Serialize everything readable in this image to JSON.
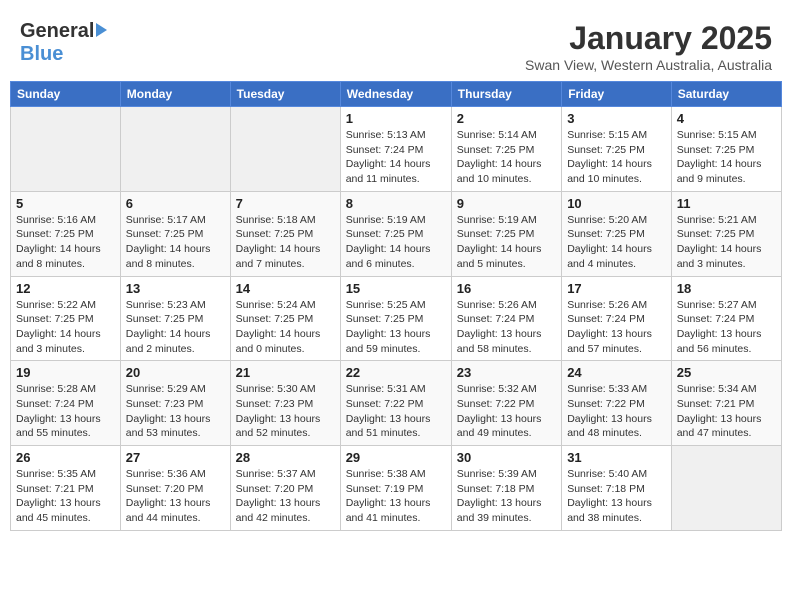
{
  "header": {
    "logo_general": "General",
    "logo_blue": "Blue",
    "title": "January 2025",
    "subtitle": "Swan View, Western Australia, Australia"
  },
  "days_of_week": [
    "Sunday",
    "Monday",
    "Tuesday",
    "Wednesday",
    "Thursday",
    "Friday",
    "Saturday"
  ],
  "weeks": [
    [
      {
        "day": "",
        "info": ""
      },
      {
        "day": "",
        "info": ""
      },
      {
        "day": "",
        "info": ""
      },
      {
        "day": "1",
        "sunrise": "Sunrise: 5:13 AM",
        "sunset": "Sunset: 7:24 PM",
        "daylight": "Daylight: 14 hours and 11 minutes."
      },
      {
        "day": "2",
        "sunrise": "Sunrise: 5:14 AM",
        "sunset": "Sunset: 7:25 PM",
        "daylight": "Daylight: 14 hours and 10 minutes."
      },
      {
        "day": "3",
        "sunrise": "Sunrise: 5:15 AM",
        "sunset": "Sunset: 7:25 PM",
        "daylight": "Daylight: 14 hours and 10 minutes."
      },
      {
        "day": "4",
        "sunrise": "Sunrise: 5:15 AM",
        "sunset": "Sunset: 7:25 PM",
        "daylight": "Daylight: 14 hours and 9 minutes."
      }
    ],
    [
      {
        "day": "5",
        "sunrise": "Sunrise: 5:16 AM",
        "sunset": "Sunset: 7:25 PM",
        "daylight": "Daylight: 14 hours and 8 minutes."
      },
      {
        "day": "6",
        "sunrise": "Sunrise: 5:17 AM",
        "sunset": "Sunset: 7:25 PM",
        "daylight": "Daylight: 14 hours and 8 minutes."
      },
      {
        "day": "7",
        "sunrise": "Sunrise: 5:18 AM",
        "sunset": "Sunset: 7:25 PM",
        "daylight": "Daylight: 14 hours and 7 minutes."
      },
      {
        "day": "8",
        "sunrise": "Sunrise: 5:19 AM",
        "sunset": "Sunset: 7:25 PM",
        "daylight": "Daylight: 14 hours and 6 minutes."
      },
      {
        "day": "9",
        "sunrise": "Sunrise: 5:19 AM",
        "sunset": "Sunset: 7:25 PM",
        "daylight": "Daylight: 14 hours and 5 minutes."
      },
      {
        "day": "10",
        "sunrise": "Sunrise: 5:20 AM",
        "sunset": "Sunset: 7:25 PM",
        "daylight": "Daylight: 14 hours and 4 minutes."
      },
      {
        "day": "11",
        "sunrise": "Sunrise: 5:21 AM",
        "sunset": "Sunset: 7:25 PM",
        "daylight": "Daylight: 14 hours and 3 minutes."
      }
    ],
    [
      {
        "day": "12",
        "sunrise": "Sunrise: 5:22 AM",
        "sunset": "Sunset: 7:25 PM",
        "daylight": "Daylight: 14 hours and 3 minutes."
      },
      {
        "day": "13",
        "sunrise": "Sunrise: 5:23 AM",
        "sunset": "Sunset: 7:25 PM",
        "daylight": "Daylight: 14 hours and 2 minutes."
      },
      {
        "day": "14",
        "sunrise": "Sunrise: 5:24 AM",
        "sunset": "Sunset: 7:25 PM",
        "daylight": "Daylight: 14 hours and 0 minutes."
      },
      {
        "day": "15",
        "sunrise": "Sunrise: 5:25 AM",
        "sunset": "Sunset: 7:25 PM",
        "daylight": "Daylight: 13 hours and 59 minutes."
      },
      {
        "day": "16",
        "sunrise": "Sunrise: 5:26 AM",
        "sunset": "Sunset: 7:24 PM",
        "daylight": "Daylight: 13 hours and 58 minutes."
      },
      {
        "day": "17",
        "sunrise": "Sunrise: 5:26 AM",
        "sunset": "Sunset: 7:24 PM",
        "daylight": "Daylight: 13 hours and 57 minutes."
      },
      {
        "day": "18",
        "sunrise": "Sunrise: 5:27 AM",
        "sunset": "Sunset: 7:24 PM",
        "daylight": "Daylight: 13 hours and 56 minutes."
      }
    ],
    [
      {
        "day": "19",
        "sunrise": "Sunrise: 5:28 AM",
        "sunset": "Sunset: 7:24 PM",
        "daylight": "Daylight: 13 hours and 55 minutes."
      },
      {
        "day": "20",
        "sunrise": "Sunrise: 5:29 AM",
        "sunset": "Sunset: 7:23 PM",
        "daylight": "Daylight: 13 hours and 53 minutes."
      },
      {
        "day": "21",
        "sunrise": "Sunrise: 5:30 AM",
        "sunset": "Sunset: 7:23 PM",
        "daylight": "Daylight: 13 hours and 52 minutes."
      },
      {
        "day": "22",
        "sunrise": "Sunrise: 5:31 AM",
        "sunset": "Sunset: 7:22 PM",
        "daylight": "Daylight: 13 hours and 51 minutes."
      },
      {
        "day": "23",
        "sunrise": "Sunrise: 5:32 AM",
        "sunset": "Sunset: 7:22 PM",
        "daylight": "Daylight: 13 hours and 49 minutes."
      },
      {
        "day": "24",
        "sunrise": "Sunrise: 5:33 AM",
        "sunset": "Sunset: 7:22 PM",
        "daylight": "Daylight: 13 hours and 48 minutes."
      },
      {
        "day": "25",
        "sunrise": "Sunrise: 5:34 AM",
        "sunset": "Sunset: 7:21 PM",
        "daylight": "Daylight: 13 hours and 47 minutes."
      }
    ],
    [
      {
        "day": "26",
        "sunrise": "Sunrise: 5:35 AM",
        "sunset": "Sunset: 7:21 PM",
        "daylight": "Daylight: 13 hours and 45 minutes."
      },
      {
        "day": "27",
        "sunrise": "Sunrise: 5:36 AM",
        "sunset": "Sunset: 7:20 PM",
        "daylight": "Daylight: 13 hours and 44 minutes."
      },
      {
        "day": "28",
        "sunrise": "Sunrise: 5:37 AM",
        "sunset": "Sunset: 7:20 PM",
        "daylight": "Daylight: 13 hours and 42 minutes."
      },
      {
        "day": "29",
        "sunrise": "Sunrise: 5:38 AM",
        "sunset": "Sunset: 7:19 PM",
        "daylight": "Daylight: 13 hours and 41 minutes."
      },
      {
        "day": "30",
        "sunrise": "Sunrise: 5:39 AM",
        "sunset": "Sunset: 7:18 PM",
        "daylight": "Daylight: 13 hours and 39 minutes."
      },
      {
        "day": "31",
        "sunrise": "Sunrise: 5:40 AM",
        "sunset": "Sunset: 7:18 PM",
        "daylight": "Daylight: 13 hours and 38 minutes."
      },
      {
        "day": "",
        "info": ""
      }
    ]
  ]
}
